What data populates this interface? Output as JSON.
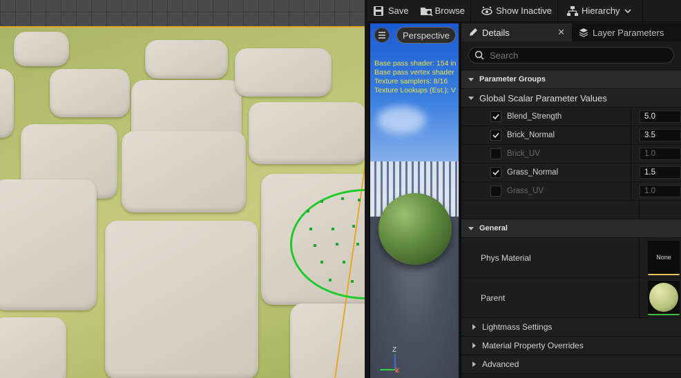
{
  "toolbar": {
    "save_label": "Save",
    "browse_label": "Browse",
    "show_inactive_label": "Show Inactive",
    "hierarchy_label": "Hierarchy"
  },
  "preview": {
    "perspective_label": "Perspective",
    "stats": [
      "Base pass shader: 154 in",
      "Base pass vertex shader",
      "Texture samplers: 8/16",
      "Texture Lookups (Est.): V"
    ],
    "axis_z": "Z",
    "axis_x": "X"
  },
  "details": {
    "tab_details": "Details",
    "tab_layer_parameters": "Layer Parameters",
    "search_placeholder": "Search",
    "parameter_groups_label": "Parameter Groups",
    "global_scalar_label": "Global Scalar Parameter Values",
    "params": [
      {
        "name": "Blend_Strength",
        "value": "5.0",
        "enabled": true
      },
      {
        "name": "Brick_Normal",
        "value": "3.5",
        "enabled": true
      },
      {
        "name": "Brick_UV",
        "value": "1.0",
        "enabled": false
      },
      {
        "name": "Grass_Normal",
        "value": "1.5",
        "enabled": true
      },
      {
        "name": "Grass_UV",
        "value": "1.0",
        "enabled": false
      }
    ],
    "general_label": "General",
    "phys_material_label": "Phys Material",
    "phys_material_value": "None",
    "parent_label": "Parent",
    "lightmass_label": "Lightmass Settings",
    "material_overrides_label": "Material Property Overrides",
    "advanced_label": "Advanced"
  },
  "colors": {
    "accent_orange": "#e8a628",
    "brush_green": "#1ecb2b",
    "stats_yellow": "#f0e24a"
  }
}
